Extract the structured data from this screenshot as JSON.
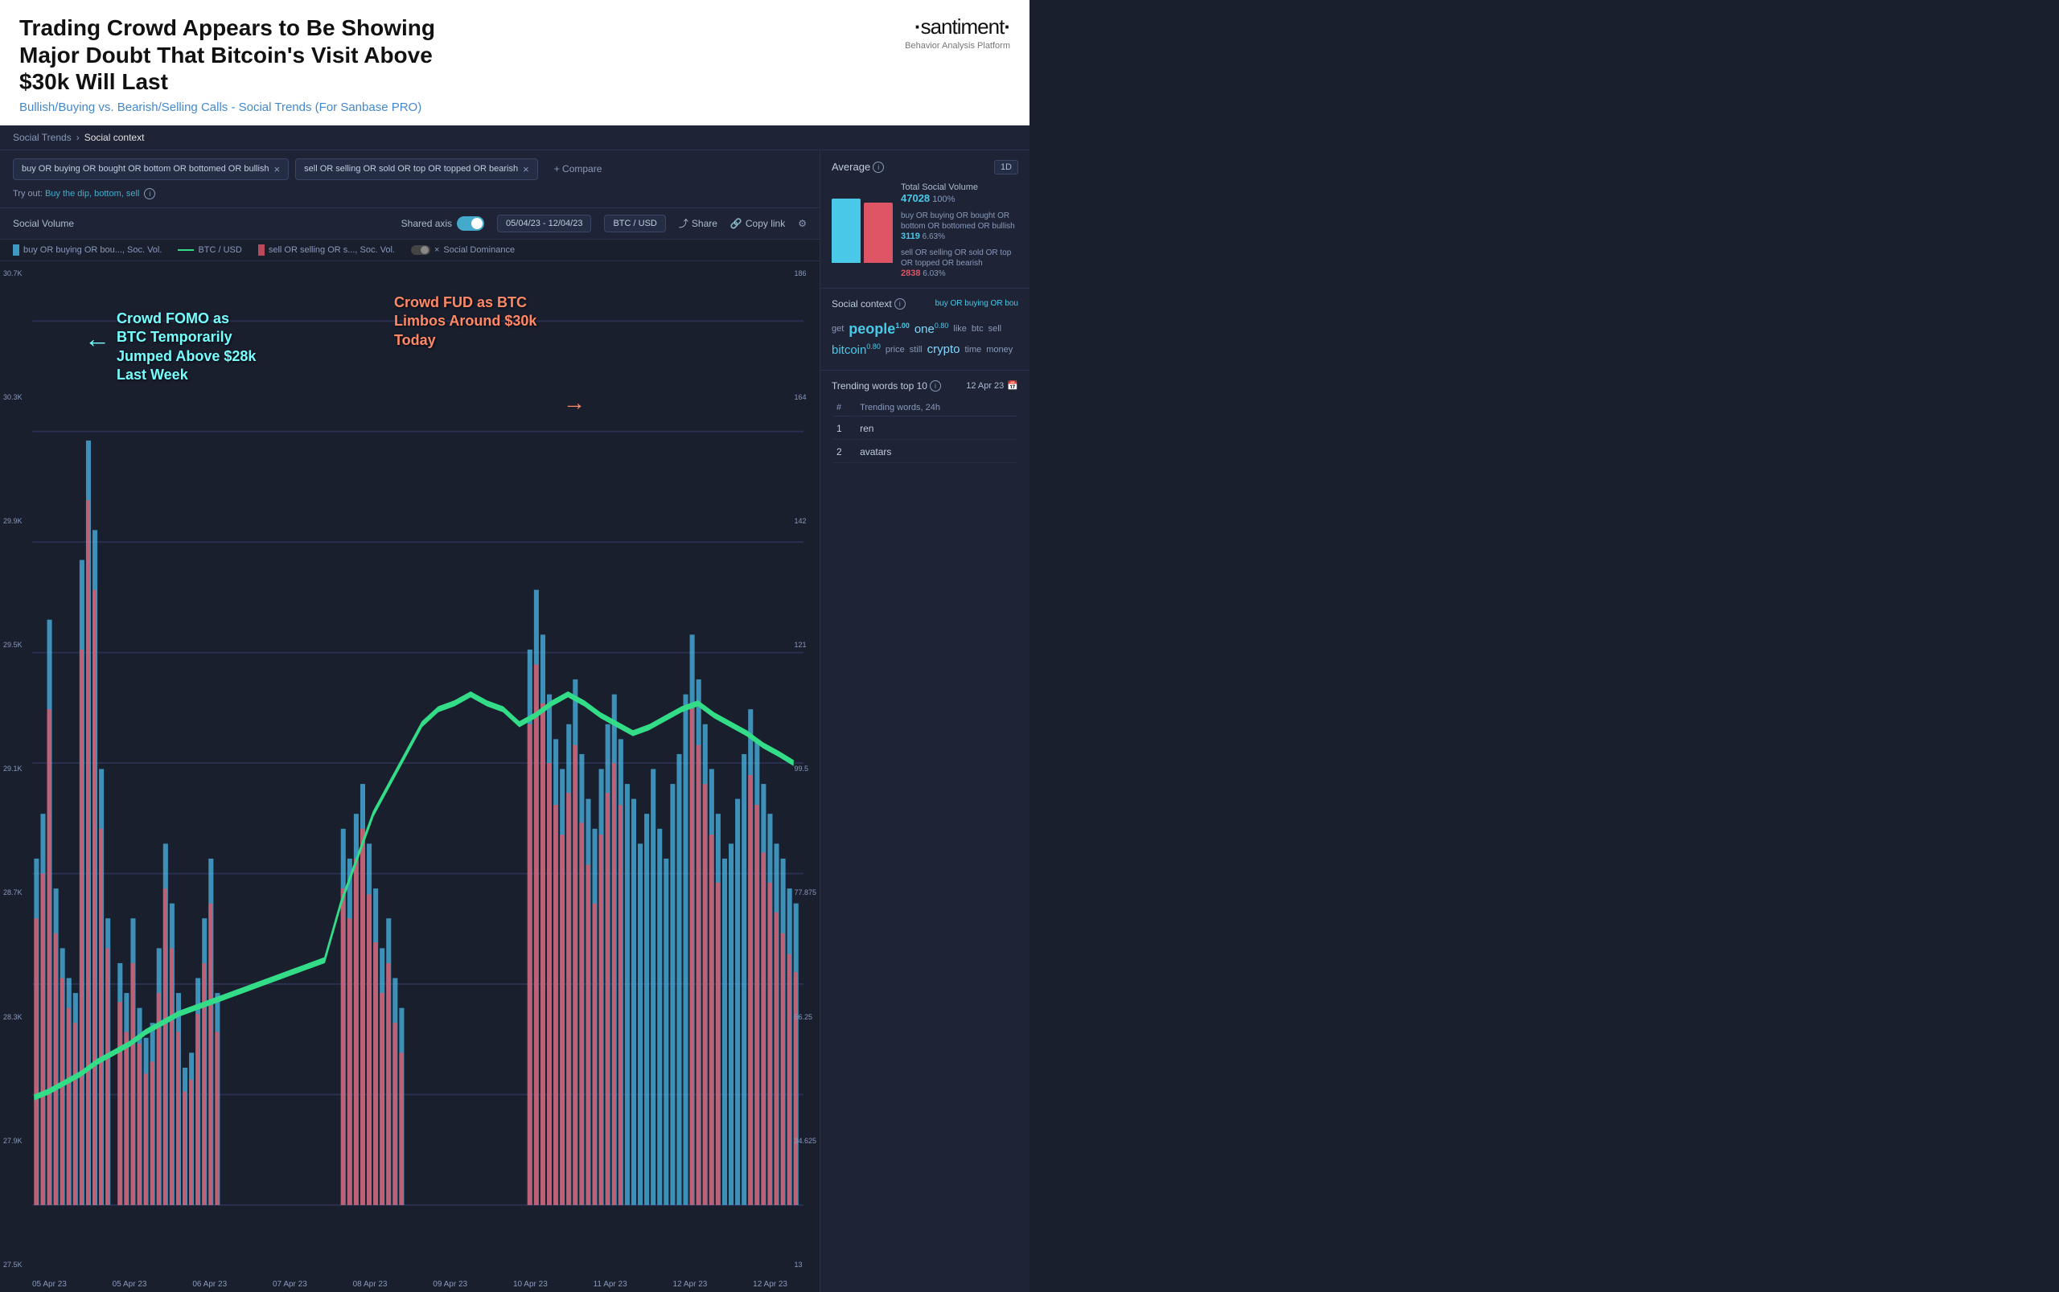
{
  "header": {
    "title": "Trading Crowd Appears to Be Showing Major Doubt That Bitcoin's Visit Above $30k Will Last",
    "subtitle": "Bullish/Buying vs. Bearish/Selling Calls - Social Trends (For Sanbase PRO)",
    "logo_name": "·santiment·",
    "logo_sub": "Behavior Analysis Platform"
  },
  "breadcrumb": {
    "parent": "Social Trends",
    "current": "Social context"
  },
  "search": {
    "pill1": "buy OR buying OR bought OR bottom OR bottomed OR bullish",
    "pill2": "sell OR selling OR sold OR top OR topped OR bearish",
    "compare_label": "+ Compare",
    "try_out_text": "Try out:",
    "try_out_link": "Buy the dip, bottom, sell"
  },
  "toolbar": {
    "social_volume_label": "Social Volume",
    "shared_axis_label": "Shared axis",
    "date_range": "05/04/23 - 12/04/23",
    "pair": "BTC / USD",
    "share_label": "Share",
    "copy_label": "Copy link"
  },
  "legend": {
    "item1": "buy OR buying OR bou..., Soc. Vol.",
    "item2": "BTC / USD",
    "item3": "sell OR selling OR s..., Soc. Vol.",
    "item4": "Social Dominance"
  },
  "chart": {
    "annotations": {
      "fomo_text": "Crowd FOMO as BTC Temporarily Jumped Above $28k Last Week",
      "fud_text": "Crowd FUD as BTC Limbos Around $30k Today"
    },
    "y_axis_left": [
      "30.7K",
      "30.3K",
      "29.9K",
      "29.5K",
      "29.1K",
      "28.7K",
      "28.3K",
      "27.9K",
      "27.5K"
    ],
    "y_axis_right": [
      "186",
      "164",
      "142",
      "121",
      "99.5",
      "77.875",
      "56.25",
      "34.625",
      "13"
    ],
    "x_axis": [
      "05 Apr 23",
      "05 Apr 23",
      "06 Apr 23",
      "07 Apr 23",
      "08 Apr 23",
      "09 Apr 23",
      "10 Apr 23",
      "11 Apr 23",
      "12 Apr 23",
      "12 Apr 23"
    ]
  },
  "average": {
    "title": "Average",
    "period": "1D",
    "total_label": "Total Social Volume",
    "total_value": "47028",
    "total_pct": "100%",
    "bar_blue_height": 80,
    "bar_red_height": 75,
    "item1_label": "buy OR buying OR bought OR bottom OR bottomed OR bullish",
    "item1_value": "3119",
    "item1_pct": "6.63%",
    "item2_label": "sell OR selling OR sold OR top OR topped OR bearish",
    "item2_value": "2838",
    "item2_pct": "6.03%"
  },
  "social_context": {
    "title": "Social context",
    "subtitle": "buy OR buying OR bou",
    "words": [
      {
        "text": "get",
        "size": "small"
      },
      {
        "text": "people",
        "size": "large",
        "badge": "1.00",
        "badge_color": "blue"
      },
      {
        "text": "one",
        "size": "medium",
        "badge": "0.80",
        "badge_color": "blue"
      },
      {
        "text": "like",
        "size": "small"
      },
      {
        "text": "btc",
        "size": "small"
      },
      {
        "text": "sell",
        "size": "small"
      },
      {
        "text": "bitcoin",
        "size": "medium",
        "badge": "0.80",
        "badge_color": "blue"
      },
      {
        "text": "price",
        "size": "small"
      },
      {
        "text": "still",
        "size": "small"
      },
      {
        "text": "crypto",
        "size": "medium"
      },
      {
        "text": "time",
        "size": "small"
      },
      {
        "text": "money",
        "size": "small"
      }
    ]
  },
  "trending": {
    "title": "Trending words top 10",
    "date": "12 Apr 23",
    "col_num": "#",
    "col_word": "Trending words, 24h",
    "items": [
      {
        "num": "1",
        "word": "ren"
      },
      {
        "num": "2",
        "word": "avatars"
      }
    ]
  }
}
